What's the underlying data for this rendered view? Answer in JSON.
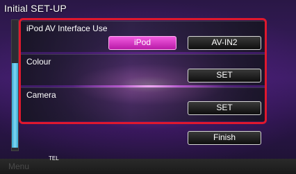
{
  "header": {
    "title": "Initial SET-UP"
  },
  "settings": {
    "ipod_av": {
      "label": "iPod AV Interface Use",
      "option_ipod": "iPod",
      "option_avin2": "AV-IN2",
      "selected": "iPod"
    },
    "colour": {
      "label": "Colour",
      "button": "SET"
    },
    "camera": {
      "label": "Camera",
      "button": "SET"
    }
  },
  "finish_button": "Finish",
  "bottom_bar": {
    "menu": "Menu",
    "tel": "TEL"
  },
  "colors": {
    "accent_active": "#e43fd0",
    "highlight_border": "#e0182d",
    "scroll_thumb": "#5cc4ea"
  }
}
